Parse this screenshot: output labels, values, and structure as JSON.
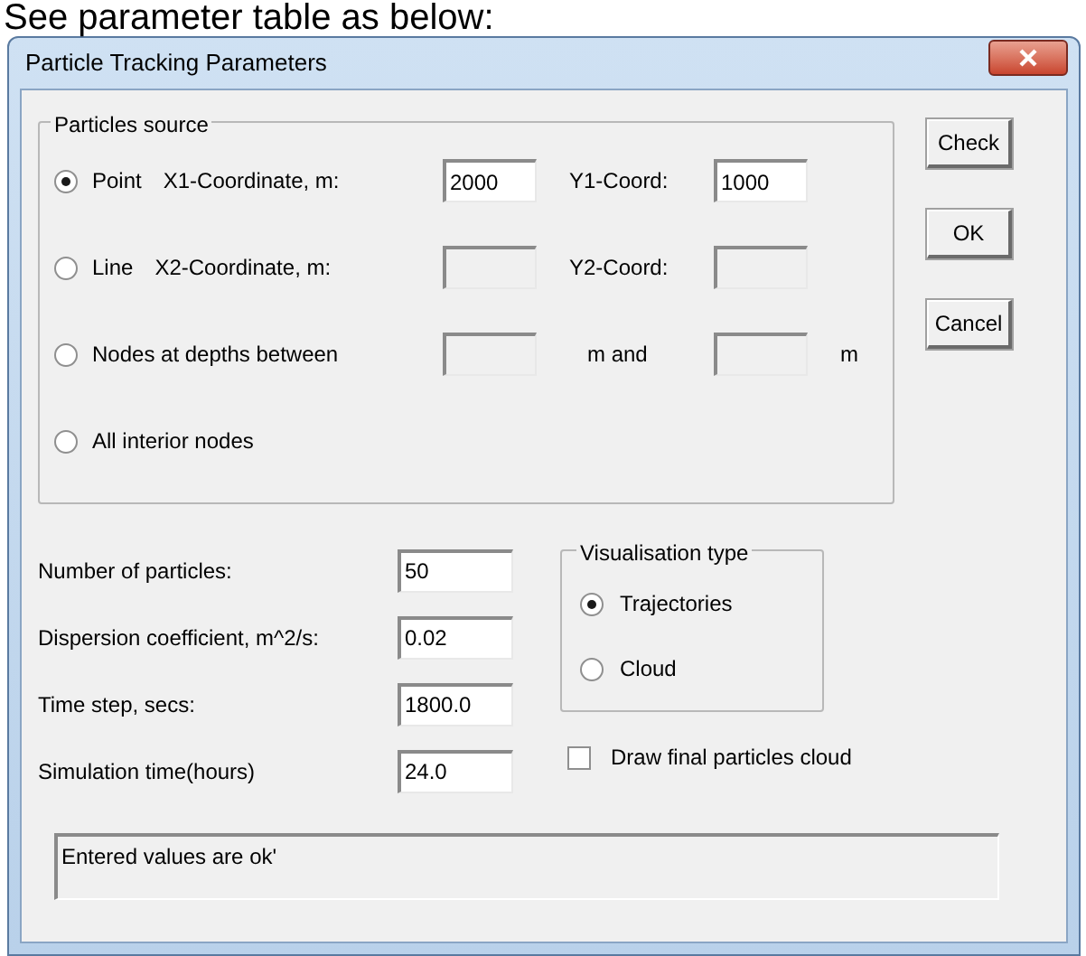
{
  "caption": "See parameter table as below:",
  "window": {
    "title": "Particle Tracking Parameters"
  },
  "source_group": {
    "title": "Particles source",
    "options": [
      {
        "kind": "coords",
        "label": "Point",
        "selected": true,
        "x_label": "X1-Coordinate, m:",
        "x_value": "2000",
        "x_disabled": false,
        "y_label": "Y1-Coord:",
        "y_value": "1000",
        "y_disabled": false
      },
      {
        "kind": "coords",
        "label": "Line",
        "selected": false,
        "x_label": "X2-Coordinate, m:",
        "x_disabled": true,
        "y_label": "Y2-Coord:",
        "y_disabled": true
      },
      {
        "kind": "depths",
        "label": "Nodes at depths between",
        "selected": false,
        "middle_label": "m and",
        "end_label": "m",
        "from_disabled": true,
        "to_disabled": true
      },
      {
        "kind": "plain",
        "label": "All interior nodes",
        "selected": false
      }
    ]
  },
  "buttons": [
    "Check",
    "OK",
    "Cancel"
  ],
  "parameters": [
    {
      "label": "Number of particles:",
      "value": "50"
    },
    {
      "label": "Dispersion coefficient, m^2/s:",
      "value": "0.02"
    },
    {
      "label": "Time step, secs:",
      "value": "1800.0"
    },
    {
      "label": "Simulation time(hours)",
      "value": "24.0"
    }
  ],
  "visualisation_group": {
    "title": "Visualisation type",
    "options": [
      {
        "label": "Trajectories",
        "selected": true
      },
      {
        "label": "Cloud",
        "selected": false
      }
    ]
  },
  "draw_cloud_checkbox": {
    "label": "Draw final particles  cloud",
    "checked": false
  },
  "status": "Entered values are ok'"
}
